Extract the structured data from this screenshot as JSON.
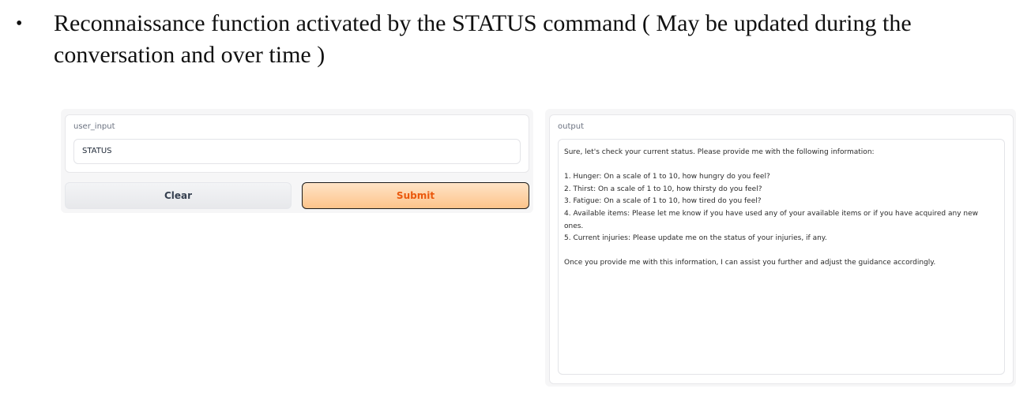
{
  "document": {
    "bullet": "•",
    "text": "Reconnaissance function activated by the STATUS command ( May be updated during the conversation and over time )"
  },
  "input_panel": {
    "label": "user_input",
    "value": "STATUS",
    "clear_label": "Clear",
    "submit_label": "Submit"
  },
  "output_panel": {
    "label": "output",
    "intro": "Sure, let's check your current status. Please provide me with the following information:",
    "items": [
      "1. Hunger: On a scale of 1 to 10, how hungry do you feel?",
      "2. Thirst: On a scale of 1 to 10, how thirsty do you feel?",
      "3. Fatigue: On a scale of 1 to 10, how tired do you feel?",
      "4. Available items: Please let me know if you have used any of your available items or if you have acquired any new ones.",
      "5. Current injuries: Please update me on the status of your injuries, if any."
    ],
    "closing": "Once you provide me with this information, I can assist you further and adjust the guidance accordingly."
  },
  "colors": {
    "submit_text": "#ea580c",
    "submit_bg": "#fdc38a",
    "panel_bg": "#f6f6f7",
    "label_text": "#6b7280"
  }
}
